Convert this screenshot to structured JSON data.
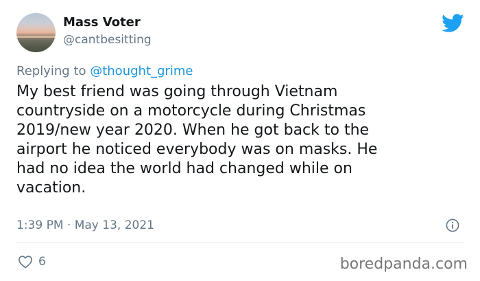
{
  "author": {
    "display_name": "Mass Voter",
    "handle": "@cantbesitting"
  },
  "reply": {
    "prefix": "Replying to",
    "mention": "@thought_grime"
  },
  "body_lines": [
    "My best friend was going through Vietnam",
    "countryside on a motorcycle during Christmas",
    "2019/new year 2020. When he got back to the",
    "airport he noticed everybody was on masks. He",
    "had no idea the world had changed while on",
    "vacation."
  ],
  "timestamp": "1:39 PM · May 13, 2021",
  "likes": {
    "count": "6"
  },
  "watermark": "boredpanda.com",
  "colors": {
    "brand_blue": "#1da1f2",
    "link_blue": "#1b95e0",
    "muted": "#657786",
    "text": "#14171a"
  },
  "icons": [
    "twitter-bird-icon",
    "info-icon",
    "heart-icon"
  ]
}
